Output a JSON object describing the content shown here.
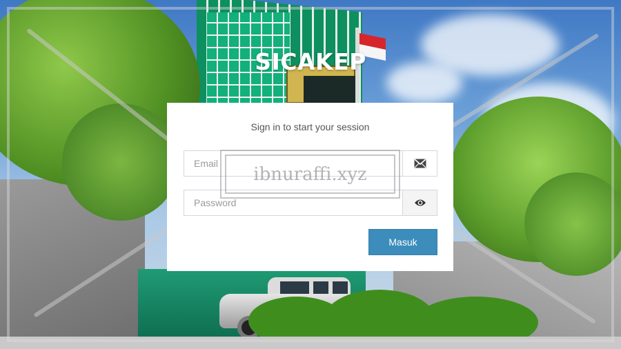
{
  "app": {
    "title": "SICAKEP"
  },
  "login": {
    "message": "Sign in to start your session",
    "email_placeholder": "Email",
    "password_placeholder": "Password",
    "submit_label": "Masuk",
    "email_icon": "envelope-icon",
    "password_icon": "eye-icon"
  },
  "watermark": {
    "text": "ibnuraffi.xyz"
  },
  "colors": {
    "button": "#3c8dbc",
    "box": "#ffffff",
    "title": "#ffffff"
  }
}
